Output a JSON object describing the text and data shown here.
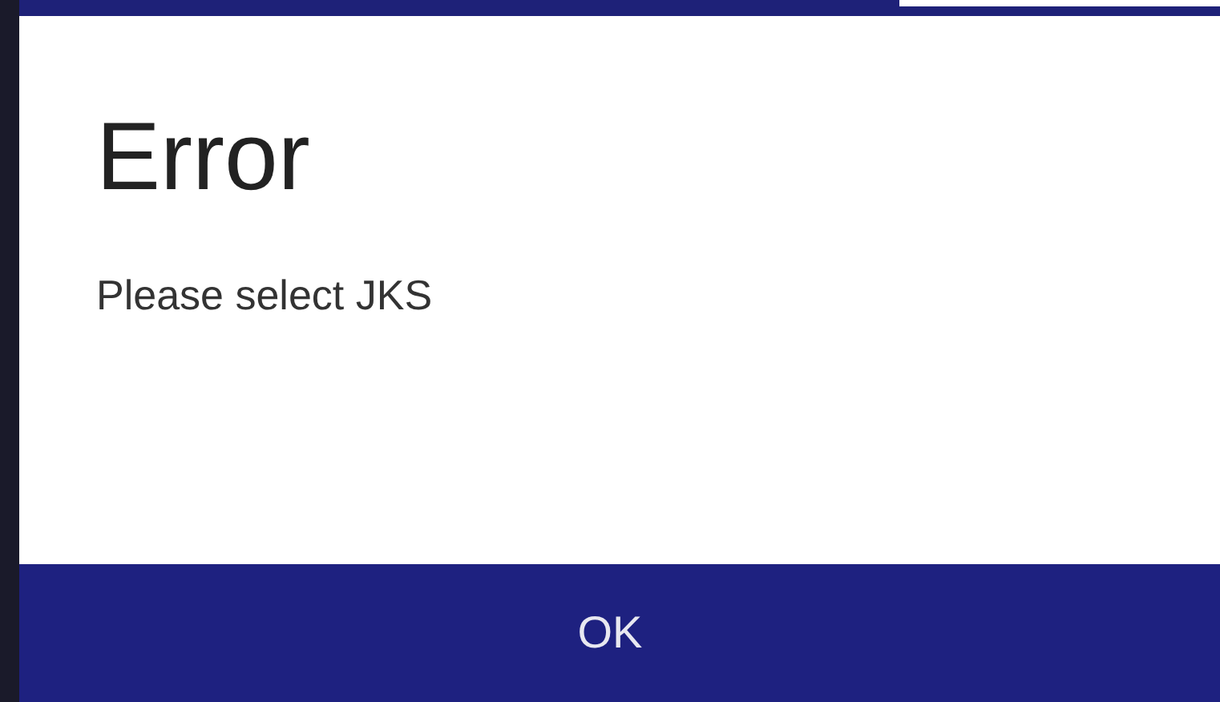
{
  "dialog": {
    "title": "Error",
    "message": "Please select JKS",
    "buttons": [
      "OK"
    ]
  }
}
